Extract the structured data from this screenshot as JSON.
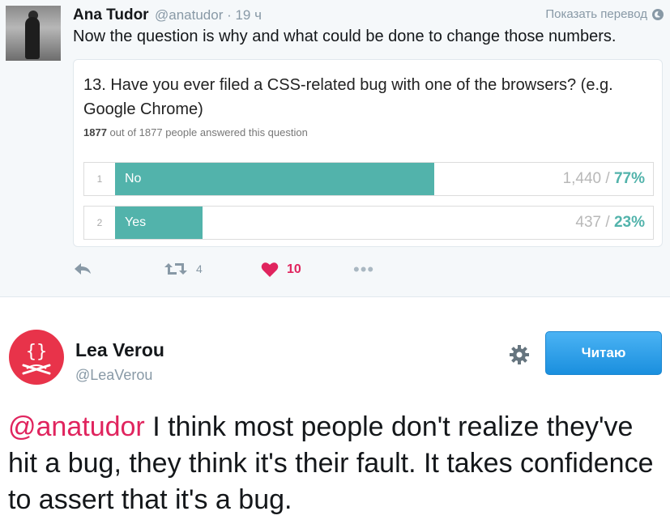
{
  "parent_tweet": {
    "author_name": "Ana Tudor",
    "author_handle": "@anatudor · 19 ч",
    "translate_label": "Показать перевод",
    "text": "Now the question is why and what could be done to change those numbers.",
    "poll": {
      "question": "13. Have you ever filed a CSS-related bug with one of the browsers? (e.g. Google Chrome)",
      "answered_count": "1877",
      "answered_rest": "out of 1877 people answered this question",
      "options": [
        {
          "number": "1",
          "label": "No",
          "count": "1,440",
          "percent": "77%",
          "fraction": 0.77
        },
        {
          "number": "2",
          "label": "Yes",
          "count": "437",
          "percent": "23%",
          "fraction": 0.23
        }
      ]
    },
    "actions": {
      "retweet_count": "4",
      "like_count": "10"
    }
  },
  "reply_tweet": {
    "author_name": "Lea Verou",
    "author_handle": "@LeaVerou",
    "follow_label": "Читаю",
    "mention": "@anatudor",
    "text": " I think most people don't realize they've hit a bug, they think it's their fault. It takes confidence to assert that it's a bug."
  },
  "colors": {
    "poll_bar": "#52b3ab",
    "like": "#e0245e",
    "follow_button": "#1da1f2",
    "lea_avatar": "#e8334a"
  }
}
